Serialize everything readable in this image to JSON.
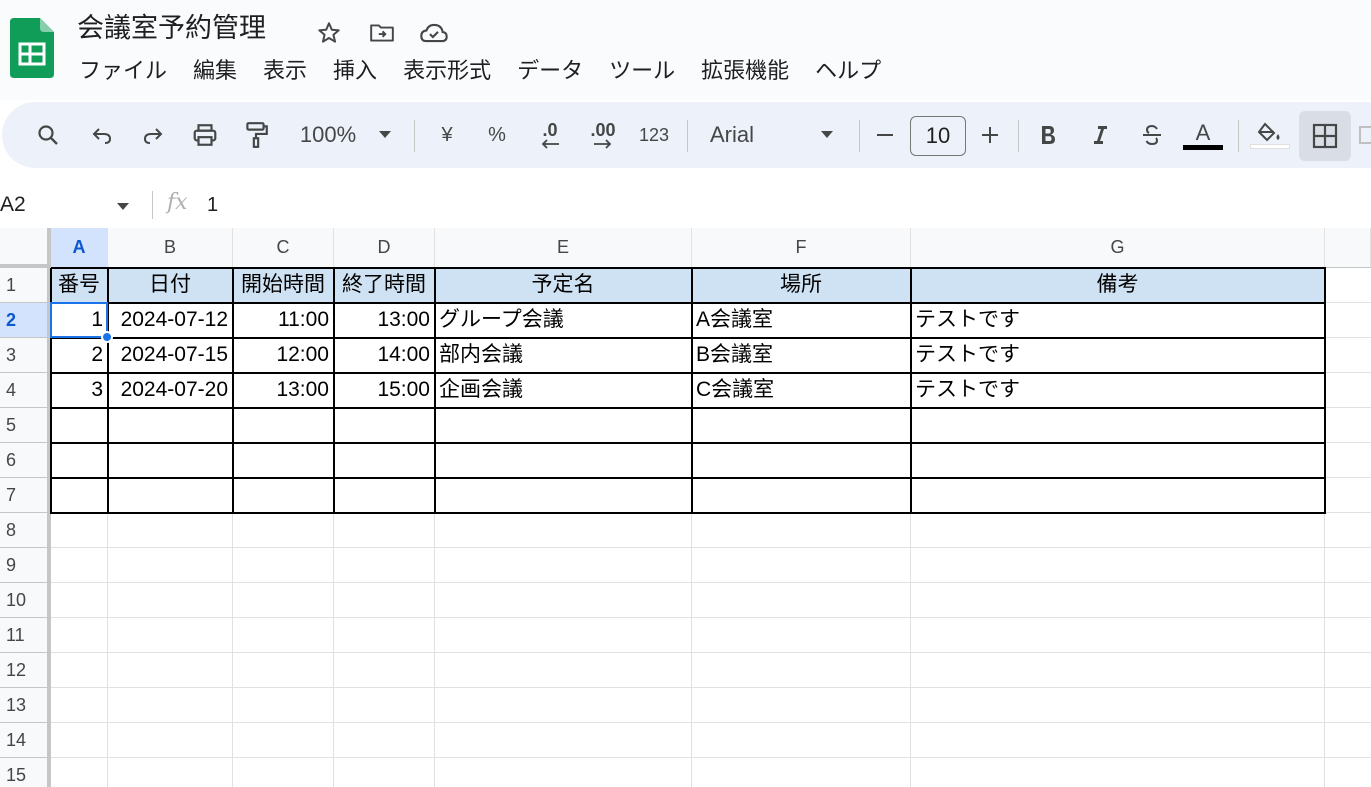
{
  "app": {
    "title": "会議室予約管理",
    "brand_color": "#0f9d58"
  },
  "menu": [
    "ファイル",
    "編集",
    "表示",
    "挿入",
    "表示形式",
    "データ",
    "ツール",
    "拡張機能",
    "ヘルプ"
  ],
  "toolbar": {
    "zoom": "100%",
    "currency": "¥",
    "percent": "%",
    "decimal_decrease": ".0",
    "decimal_increase": ".00",
    "number_format": "123",
    "font": "Arial",
    "font_size": "10",
    "text_color_label": "A"
  },
  "formula_bar": {
    "cell_ref": "A2",
    "fx": "fx",
    "value": "1"
  },
  "grid": {
    "columns": [
      "A",
      "B",
      "C",
      "D",
      "E",
      "F",
      "G"
    ],
    "rows": [
      "1",
      "2",
      "3",
      "4",
      "5",
      "6",
      "7",
      "8",
      "9",
      "10",
      "11",
      "12",
      "13",
      "14",
      "15"
    ],
    "selected_cell": "A2",
    "header_fill": "#cfe2f3",
    "table": {
      "headers": [
        "番号",
        "日付",
        "開始時間",
        "終了時間",
        "予定名",
        "場所",
        "備考"
      ],
      "rows": [
        [
          "1",
          "2024-07-12",
          "11:00",
          "13:00",
          "グループ会議",
          "A会議室",
          "テストです"
        ],
        [
          "2",
          "2024-07-15",
          "12:00",
          "14:00",
          "部内会議",
          "B会議室",
          "テストです"
        ],
        [
          "3",
          "2024-07-20",
          "13:00",
          "15:00",
          "企画会議",
          "C会議室",
          "テストです"
        ]
      ]
    }
  }
}
